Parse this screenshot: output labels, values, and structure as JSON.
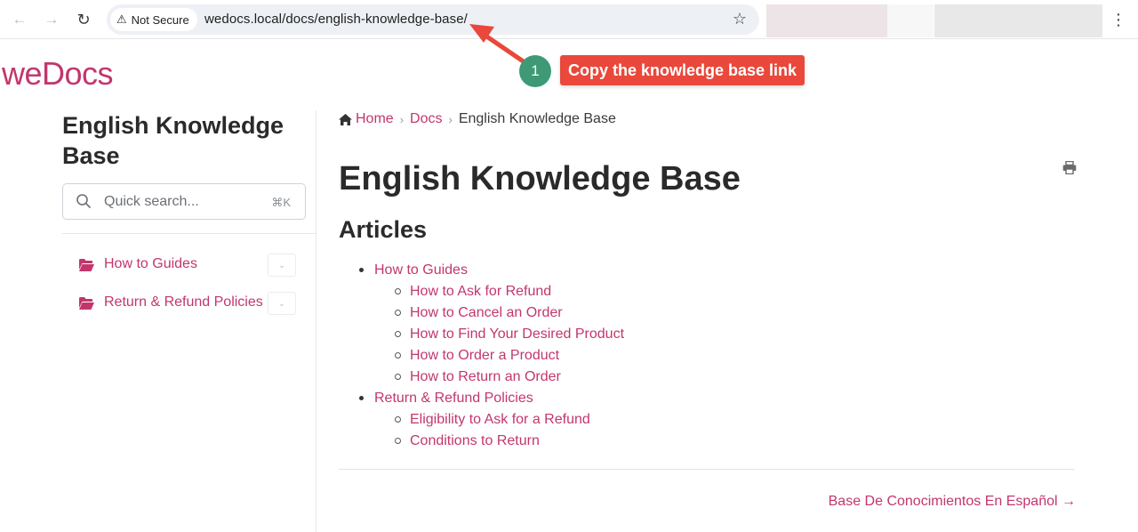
{
  "browser": {
    "security_label": "Not Secure",
    "url": "wedocs.local/docs/english-knowledge-base/",
    "icons": {
      "back": "arrow-left-icon",
      "forward": "arrow-right-icon",
      "reload": "reload-icon",
      "security": "warning-triangle-icon",
      "bookmark": "star-icon",
      "menu": "kebab-menu-icon"
    }
  },
  "annotation": {
    "step_number": "1",
    "label": "Copy the knowledge base link",
    "badge_color": "#3d9a74",
    "label_color": "#e9483b"
  },
  "site": {
    "logo": "weDocs",
    "accent_color": "#c2366e"
  },
  "sidebar": {
    "title": "English Knowledge Base",
    "search": {
      "placeholder": "Quick search...",
      "shortcut": "⌘K"
    },
    "items": [
      {
        "label": "How to Guides",
        "icon": "folder-open-icon"
      },
      {
        "label": "Return & Refund Policies",
        "icon": "folder-open-icon"
      }
    ]
  },
  "breadcrumb": {
    "home": "Home",
    "docs": "Docs",
    "current": "English Knowledge Base"
  },
  "main": {
    "title": "English Knowledge Base",
    "articles_heading": "Articles",
    "sections": [
      {
        "label": "How to Guides",
        "articles": [
          "How to Ask for Refund",
          "How to Cancel an Order",
          "How to Find Your Desired Product",
          "How to Order a Product",
          "How to Return an Order"
        ]
      },
      {
        "label": "Return & Refund Policies",
        "articles": [
          "Eligibility to Ask for a Refund",
          "Conditions to Return"
        ]
      }
    ],
    "next_link": "Base De Conocimientos En Español →"
  }
}
